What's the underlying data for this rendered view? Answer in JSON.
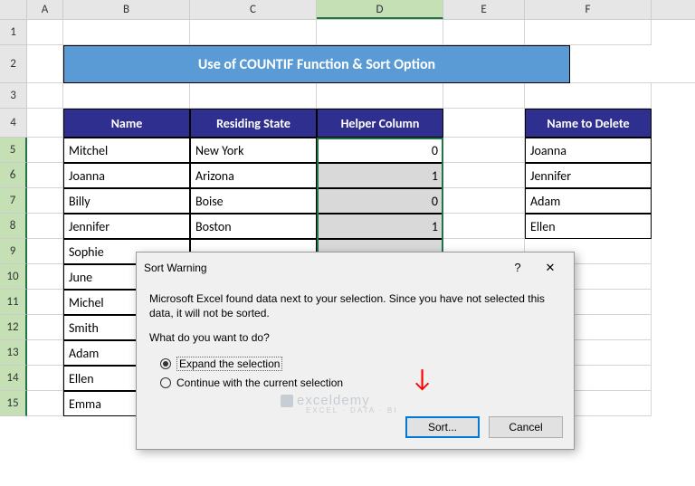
{
  "columns": [
    "A",
    "B",
    "C",
    "D",
    "E",
    "F"
  ],
  "rows": [
    "1",
    "2",
    "3",
    "4",
    "5",
    "6",
    "7",
    "8",
    "9",
    "10",
    "11",
    "12",
    "13",
    "14",
    "15"
  ],
  "title": "Use of COUNTIF Function & Sort Option",
  "headers": {
    "name": "Name",
    "state": "Residing State",
    "helper": "Helper Column",
    "delete": "Name to Delete"
  },
  "main_table": [
    {
      "name": "Mitchel",
      "state": "New York",
      "helper": "0"
    },
    {
      "name": "Joanna",
      "state": "Arizona",
      "helper": "1"
    },
    {
      "name": "Billy",
      "state": "Boise",
      "helper": "0"
    },
    {
      "name": "Jennifer",
      "state": "Boston",
      "helper": "1"
    },
    {
      "name": "Sophie",
      "state": "",
      "helper": ""
    },
    {
      "name": "June",
      "state": "",
      "helper": ""
    },
    {
      "name": "Michel",
      "state": "",
      "helper": ""
    },
    {
      "name": "Smith",
      "state": "",
      "helper": ""
    },
    {
      "name": "Adam",
      "state": "",
      "helper": ""
    },
    {
      "name": "Ellen",
      "state": "",
      "helper": ""
    },
    {
      "name": "Emma",
      "state": "",
      "helper": ""
    }
  ],
  "delete_list": [
    "Joanna",
    "Jennifer",
    "Adam",
    "Ellen"
  ],
  "dialog": {
    "title": "Sort Warning",
    "help": "?",
    "close": "✕",
    "message": "Microsoft Excel found data next to your selection.  Since you have not selected this data, it will not be sorted.",
    "question": "What do you want to do?",
    "option1": "Expand the selection",
    "option2": "Continue with the current selection",
    "sort_btn": "Sort...",
    "cancel_btn": "Cancel"
  },
  "watermark": {
    "main": "exceldemy",
    "sub": "EXCEL · DATA · BI"
  }
}
